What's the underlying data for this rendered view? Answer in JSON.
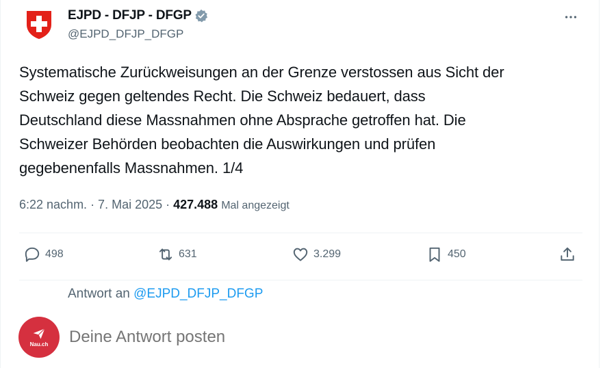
{
  "colors": {
    "accent": "#1d9bf0",
    "secondary_text": "#536471",
    "verified_badge": "#829aab",
    "swiss_red": "#e32119",
    "compose_avatar": "#d5303f"
  },
  "author": {
    "display_name": "EJPD - DFJP - DFGP",
    "handle": "@EJPD_DFJP_DFGP",
    "avatar_icon": "swiss-shield-icon",
    "verified_icon": "verified-badge-icon"
  },
  "tweet": {
    "text": "Systematische Zurückweisungen an der Grenze verstossen aus Sicht der\nSchweiz gegen geltendes Recht. Die Schweiz bedauert, dass\nDeutschland diese Massnahmen ohne Absprache getroffen hat. Die\nSchweizer Behörden beobachten die Auswirkungen und prüfen\ngegebenenfalls Massnahmen. 1/4",
    "time": "6:22 nachm. · 7. Mai 2025",
    "separator": "·",
    "views": "427.488",
    "views_label": "Mal angezeigt"
  },
  "actions": {
    "replies": "498",
    "reposts": "631",
    "likes": "3.299",
    "bookmarks": "450"
  },
  "reply_context": {
    "prefix": "Antwort an",
    "handle": "@EJPD_DFJP_DFGP"
  },
  "compose": {
    "placeholder": "Deine Antwort posten",
    "avatar_brand": "Nau.ch"
  }
}
